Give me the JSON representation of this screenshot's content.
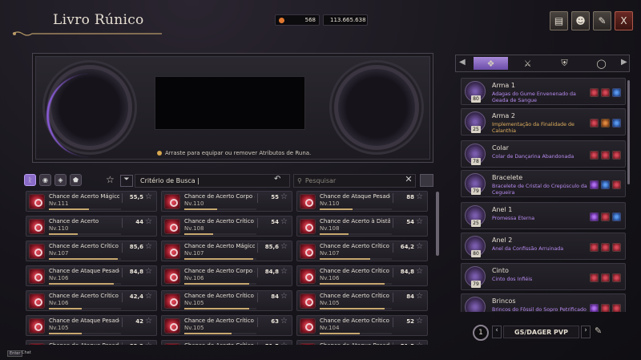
{
  "header": {
    "title": "Livro Rúnico",
    "currency_1": "568",
    "currency_2": "113.665.638",
    "buttons": [
      {
        "icon": "journal-icon"
      },
      {
        "icon": "character-icon"
      },
      {
        "icon": "quest-icon"
      },
      {
        "icon": "close-icon",
        "label": "X"
      }
    ]
  },
  "frame": {
    "hint": "Arraste para equipar ou remover Atributos de Runa."
  },
  "filter": {
    "criteria_label": "Critério de Busca",
    "search_placeholder": "Pesquisar"
  },
  "runes": [
    {
      "name": "Chance de Acerto Mágico",
      "level": "Nv.111",
      "value": "55,5",
      "fill": 0.55
    },
    {
      "name": "Chance de Acerto Corpo a C",
      "level": "Nv.110",
      "value": "55",
      "fill": 0.45
    },
    {
      "name": "Chance de Ataque Pesado M",
      "level": "Nv.110",
      "value": "88",
      "fill": 0.45
    },
    {
      "name": "Chance de Acerto",
      "level": "Nv.110",
      "value": "44",
      "fill": 0.4
    },
    {
      "name": "Chance de Acerto Crítico à D",
      "level": "Nv.108",
      "value": "54",
      "fill": 0.4
    },
    {
      "name": "Chance de Acerto à Distânci",
      "level": "Nv.108",
      "value": "54",
      "fill": 0.4
    },
    {
      "name": "Chance de Acerto Crítico à D",
      "level": "Nv.107",
      "value": "85,6",
      "fill": 0.95
    },
    {
      "name": "Chance de Acerto Mágico cor",
      "level": "Nv.107",
      "value": "85,6",
      "fill": 0.95
    },
    {
      "name": "Chance de Acerto Crítico cor",
      "level": "Nv.107",
      "value": "64,2",
      "fill": 0.7
    },
    {
      "name": "Chance de Ataque Pesado Cc",
      "level": "Nv.106",
      "value": "84,8",
      "fill": 0.9
    },
    {
      "name": "Chance de Acerto Corpo a C",
      "level": "Nv.106",
      "value": "84,8",
      "fill": 0.9
    },
    {
      "name": "Chance de Acerto Crítico cor",
      "level": "Nv.106",
      "value": "84,8",
      "fill": 0.9
    },
    {
      "name": "Chance de Acerto Crítico",
      "level": "Nv.106",
      "value": "42,4",
      "fill": 0.45
    },
    {
      "name": "Chance de Acerto Crítico Co",
      "level": "Nv.105",
      "value": "84",
      "fill": 0.9
    },
    {
      "name": "Chance de Acerto Crítico Má",
      "level": "Nv.105",
      "value": "84",
      "fill": 0.9
    },
    {
      "name": "Chance de Ataque Pesado",
      "level": "Nv.105",
      "value": "42",
      "fill": 0.45
    },
    {
      "name": "Chance de Acerto Crítico à D",
      "level": "Nv.105",
      "value": "63",
      "fill": 0.65
    },
    {
      "name": "Chance de Acerto Crítico Co",
      "level": "Nv.104",
      "value": "52",
      "fill": 0.55
    },
    {
      "name": "Chance de Ataque Pesado à",
      "level": "",
      "value": "83,2",
      "fill": 0.9
    },
    {
      "name": "Chance de Acerto Crítico Mág",
      "level": "",
      "value": "51,5",
      "fill": 0.55
    },
    {
      "name": "Chance de Ataque Pesado Cc",
      "level": "",
      "value": "51,5",
      "fill": 0.55
    }
  ],
  "slots": [
    {
      "name": "Arma 1",
      "desc": "Adagas do Gume Envenenado da Geada de Sangue",
      "badge": "80",
      "desc_color": "purple",
      "runes": [
        "r",
        "r",
        "b"
      ]
    },
    {
      "name": "Arma 2",
      "desc": "Implementação da Finalidade de Calanthia",
      "badge": "25",
      "desc_color": "gold",
      "runes": [
        "r",
        "o",
        "b"
      ]
    },
    {
      "name": "Colar",
      "desc": "Colar de Dançarina Abandonada",
      "badge": "78",
      "desc_color": "purple",
      "runes": [
        "r",
        "r",
        "r"
      ]
    },
    {
      "name": "Bracelete",
      "desc": "Bracelete de Cristal do Crepúsculo da Cegueira",
      "badge": "79",
      "desc_color": "purple",
      "runes": [
        "p",
        "b",
        "r"
      ]
    },
    {
      "name": "Anel 1",
      "desc": "Promessa Eterna",
      "badge": "25",
      "desc_color": "purple",
      "runes": [
        "p",
        "r",
        "b"
      ]
    },
    {
      "name": "Anel 2",
      "desc": "Anel da Confissão Arruinada",
      "badge": "80",
      "desc_color": "purple",
      "runes": [
        "r",
        "r",
        "r"
      ]
    },
    {
      "name": "Cinto",
      "desc": "Cinto dos Infiéis",
      "badge": "79",
      "desc_color": "purple",
      "runes": [
        "r",
        "r",
        "r"
      ]
    },
    {
      "name": "Brincos",
      "desc": "Brincos do Fôssil do Sopro Petrificado",
      "badge": "",
      "desc_color": "purple",
      "runes": [
        "p",
        "r",
        "r"
      ]
    }
  ],
  "preset": {
    "number": "1",
    "name": "GS/DAGER PVP"
  },
  "footer": {
    "chat_key": "Enter",
    "chat_label": "Chat"
  }
}
